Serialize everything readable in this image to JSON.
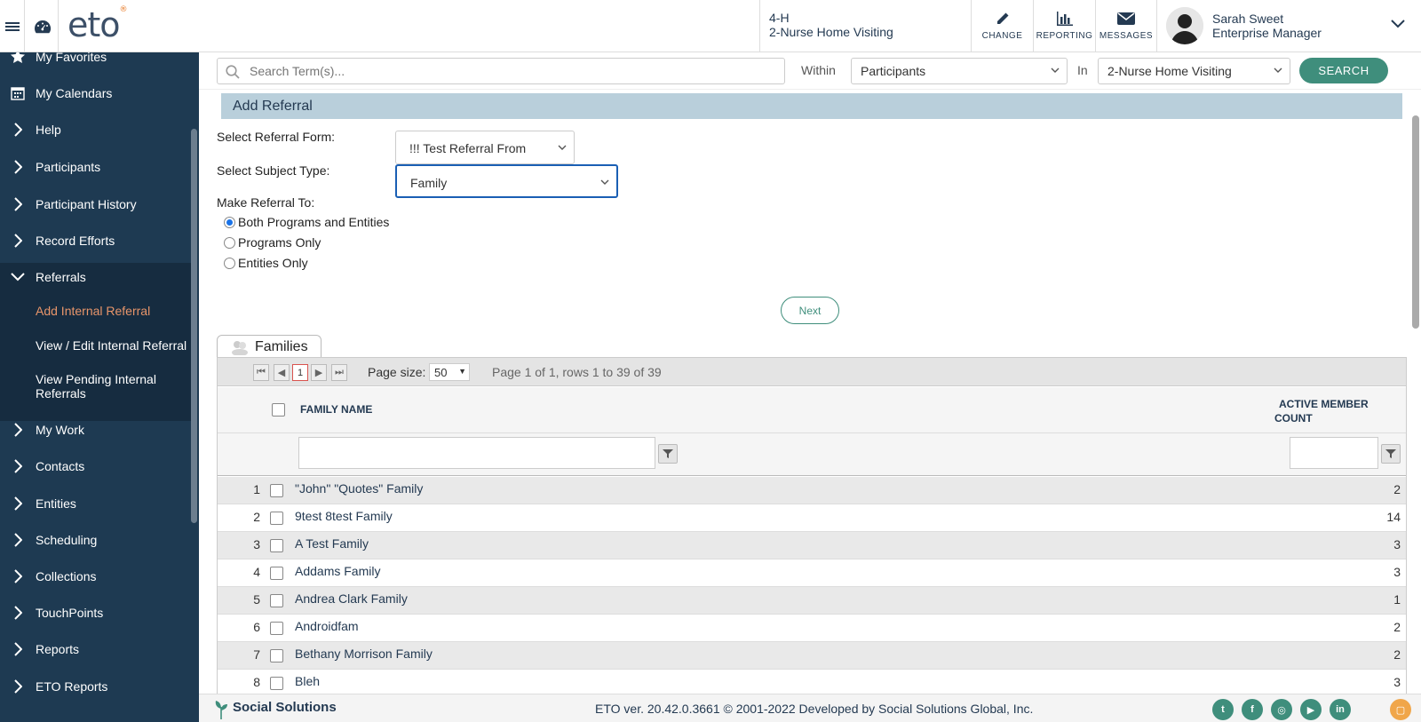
{
  "header": {
    "logo": "eto",
    "program_line1": "4-H",
    "program_line2": "2-Nurse Home Visiting",
    "change_label": "CHANGE",
    "reporting_label": "REPORTING",
    "messages_label": "MESSAGES",
    "user_name": "Sarah Sweet",
    "user_role": "Enterprise Manager"
  },
  "search": {
    "placeholder": "Search Term(s)...",
    "within_label": "Within",
    "within_value": "Participants",
    "in_label": "In",
    "in_value": "2-Nurse Home Visiting",
    "button": "SEARCH"
  },
  "sidebar": {
    "items": [
      {
        "label": "My Favorites",
        "icon": "star-icon"
      },
      {
        "label": "My Calendars",
        "icon": "calendar-icon"
      },
      {
        "label": "Help",
        "icon": "chevron-right-icon"
      },
      {
        "label": "Participants",
        "icon": "chevron-right-icon"
      },
      {
        "label": "Participant History",
        "icon": "chevron-right-icon"
      },
      {
        "label": "Record Efforts",
        "icon": "chevron-right-icon"
      },
      {
        "label": "Referrals",
        "icon": "chevron-down-icon"
      },
      {
        "label": "My Work",
        "icon": "chevron-right-icon"
      },
      {
        "label": "Contacts",
        "icon": "chevron-right-icon"
      },
      {
        "label": "Entities",
        "icon": "chevron-right-icon"
      },
      {
        "label": "Scheduling",
        "icon": "chevron-right-icon"
      },
      {
        "label": "Collections",
        "icon": "chevron-right-icon"
      },
      {
        "label": "TouchPoints",
        "icon": "chevron-right-icon"
      },
      {
        "label": "Reports",
        "icon": "chevron-right-icon"
      },
      {
        "label": "ETO Reports",
        "icon": "chevron-right-icon"
      }
    ],
    "sub_items": [
      "Add Internal Referral",
      "View / Edit Internal Referral",
      "View Pending Internal Referrals"
    ],
    "active_color": "#e8956a"
  },
  "form": {
    "title": "Add Referral",
    "referral_form_label": "Select Referral Form:",
    "referral_form_value": "!!! Test Referral From",
    "subject_type_label": "Select Subject Type:",
    "subject_type_value": "Family",
    "make_referral_label": "Make Referral To:",
    "options": [
      "Both Programs and Entities",
      "Programs Only",
      "Entities Only"
    ],
    "selected_option": 0,
    "next_button": "Next"
  },
  "grid": {
    "tab_label": "Families",
    "current_page": "1",
    "page_size_label": "Page size:",
    "page_size": "50",
    "page_info": "Page 1 of 1, rows 1 to 39 of 39",
    "col_name": "FAMILY NAME",
    "col_count_line1": "ACTIVE MEMBER",
    "col_count_line2": "COUNT",
    "rows": [
      {
        "num": "1",
        "name": "\"John\" \"Quotes\" Family",
        "count": "2"
      },
      {
        "num": "2",
        "name": "9test 8test Family",
        "count": "14"
      },
      {
        "num": "3",
        "name": "A Test Family",
        "count": "3"
      },
      {
        "num": "4",
        "name": "Addams Family",
        "count": "3"
      },
      {
        "num": "5",
        "name": "Andrea Clark Family",
        "count": "1"
      },
      {
        "num": "6",
        "name": "Androidfam",
        "count": "2"
      },
      {
        "num": "7",
        "name": "Bethany Morrison Family",
        "count": "2"
      },
      {
        "num": "8",
        "name": "Bleh",
        "count": "3"
      }
    ]
  },
  "footer": {
    "brand": "Social Solutions",
    "text": "ETO ver. 20.42.0.3661 © 2001-2022 Developed by Social Solutions Global, Inc.",
    "social": [
      "twitter-icon",
      "facebook-icon",
      "instagram-icon",
      "youtube-icon",
      "linkedin-icon",
      "chat-icon"
    ]
  },
  "colors": {
    "sidebar_bg": "#1e3a52",
    "accent": "#3f8e7c",
    "title_bar": "#b9cfdb"
  }
}
